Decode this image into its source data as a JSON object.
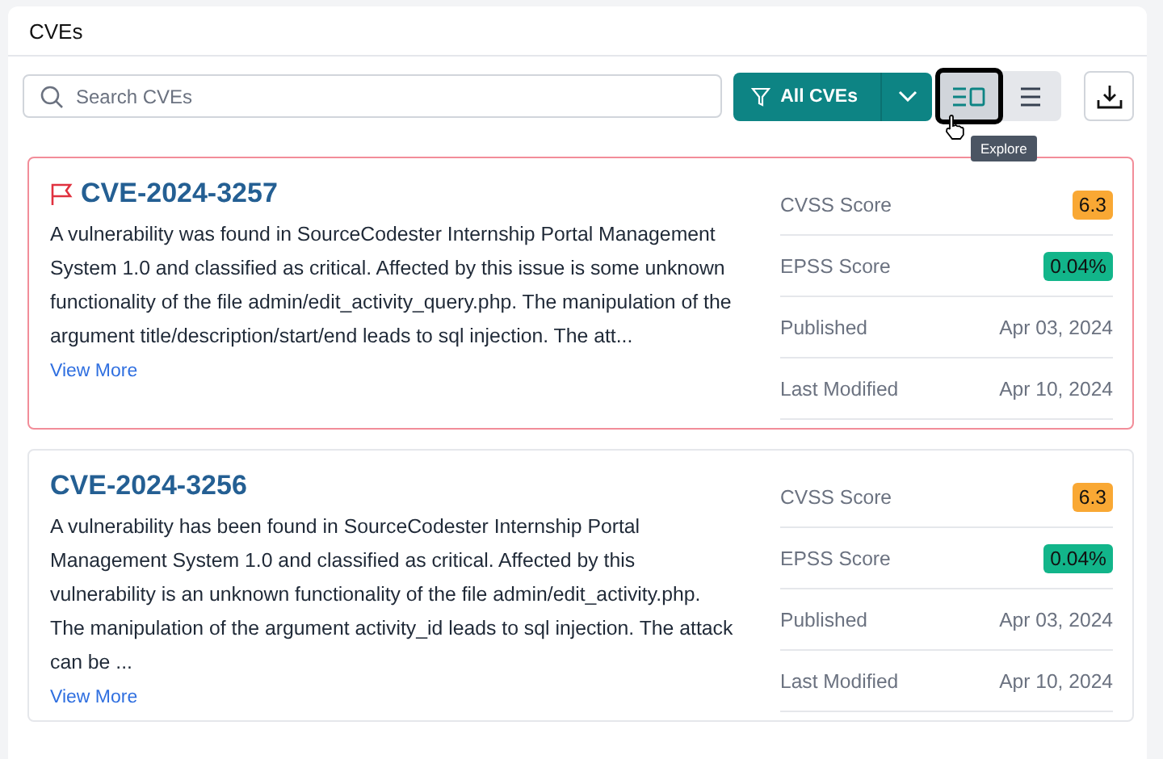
{
  "panel": {
    "title": "CVEs"
  },
  "search": {
    "placeholder": "Search CVEs"
  },
  "filter": {
    "label": "All CVEs"
  },
  "views": [
    {
      "kind": "explore",
      "selected": true
    },
    {
      "kind": "list",
      "selected": false
    }
  ],
  "tooltip": "Explore",
  "cves": [
    {
      "id": "CVE-2024-3257",
      "flagged": true,
      "description": "A vulnerability was found in SourceCodester Internship Portal Management System 1.0 and classified as critical. Affected by this issue is some unknown functionality of the file admin/edit_activity_query.php. The manipulation of the argument title/description/start/end leads to sql injection. The att...",
      "link": "View More",
      "metrics": [
        {
          "kind": "badge",
          "label": "CVSS Score",
          "value": "6.3",
          "color": "#f9a834"
        },
        {
          "kind": "badge",
          "label": "EPSS Score",
          "value": "0.04%",
          "color": "#12b58a"
        },
        {
          "kind": "text",
          "label": "Published",
          "value": "Apr 03, 2024"
        },
        {
          "kind": "text",
          "label": "Last Modified",
          "value": "Apr 10, 2024"
        }
      ]
    },
    {
      "id": "CVE-2024-3256",
      "flagged": false,
      "description": "A vulnerability has been found in SourceCodester Internship Portal Management System 1.0 and classified as critical. Affected by this vulnerability is an unknown functionality of the file admin/edit_activity.php. The manipulation of the argument activity_id leads to sql injection. The attack can be ...",
      "link": "View More",
      "metrics": [
        {
          "kind": "badge",
          "label": "CVSS Score",
          "value": "6.3",
          "color": "#f9a834"
        },
        {
          "kind": "badge",
          "label": "EPSS Score",
          "value": "0.04%",
          "color": "#12b58a"
        },
        {
          "kind": "text",
          "label": "Published",
          "value": "Apr 03, 2024"
        },
        {
          "kind": "text",
          "label": "Last Modified",
          "value": "Apr 10, 2024"
        }
      ]
    }
  ]
}
